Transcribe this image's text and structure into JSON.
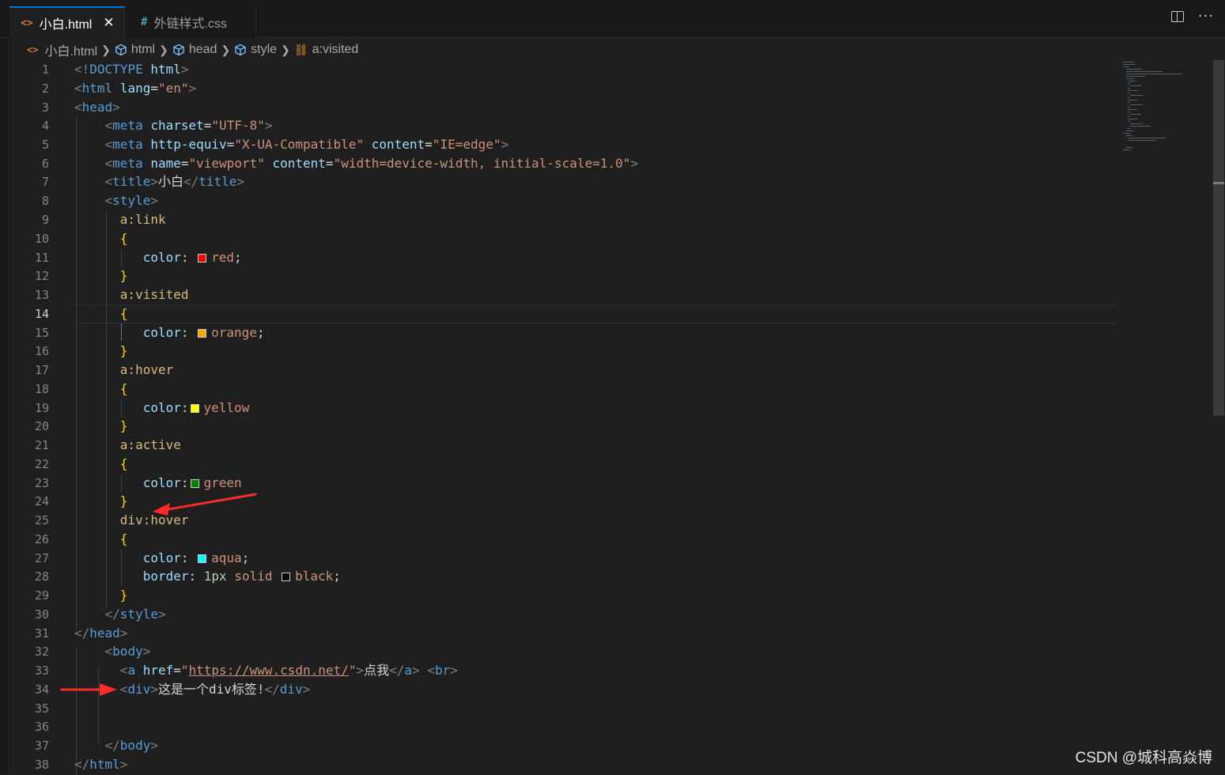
{
  "tabs": [
    {
      "label": "小白.html",
      "icon": "html-file-icon",
      "active": true
    },
    {
      "label": "外链样式.css",
      "icon": "css-file-icon",
      "active": false
    }
  ],
  "tab_close": "✕",
  "breadcrumb": [
    {
      "label": "小白.html",
      "icon": "html-file-icon"
    },
    {
      "label": "html",
      "icon": "cube-icon"
    },
    {
      "label": "head",
      "icon": "cube-icon"
    },
    {
      "label": "style",
      "icon": "cube-icon"
    },
    {
      "label": "a:visited",
      "icon": "css-selector-icon"
    }
  ],
  "current_line": 14,
  "code": {
    "doctype_open": "<!",
    "doctype_kw": "DOCTYPE",
    "doctype_name": "html",
    "lang_attr": "lang",
    "lang_val": "\"en\"",
    "charset_attr": "charset",
    "charset_val": "\"UTF-8\"",
    "equiv_attr": "http-equiv",
    "equiv_val": "\"X-UA-Compatible\"",
    "content_attr": "content",
    "content_val1": "\"IE=edge\"",
    "name_attr": "name",
    "name_val": "\"viewport\"",
    "content_val2": "\"width=device-width, initial-scale=1.0\"",
    "title_text": "小白",
    "sel_link": "a:link",
    "sel_visited": "a:visited",
    "sel_hover": "a:hover",
    "sel_active": "a:active",
    "sel_divhover": "div:hover",
    "prop_color": "color",
    "prop_border": "border",
    "val_red": "red",
    "val_orange": "orange",
    "val_yellow": "yellow",
    "val_green": "green",
    "val_aqua": "aqua",
    "val_1px": "1px",
    "val_solid": "solid",
    "val_black": "black",
    "href_attr": "href",
    "href_url": "https://www.csdn.net/",
    "link_text": "点我",
    "div_text": "这是一个div标签!",
    "tag_html": "html",
    "tag_head": "head",
    "tag_meta": "meta",
    "tag_title": "title",
    "tag_style": "style",
    "tag_body": "body",
    "tag_a": "a",
    "tag_br": "br",
    "tag_div": "div"
  },
  "swatches": {
    "red": "#ff0000",
    "orange": "#ffa500",
    "yellow": "#ffff00",
    "green": "#008000",
    "aqua": "#00ffff",
    "black": "#000000"
  },
  "watermark": "CSDN @城科高焱博"
}
